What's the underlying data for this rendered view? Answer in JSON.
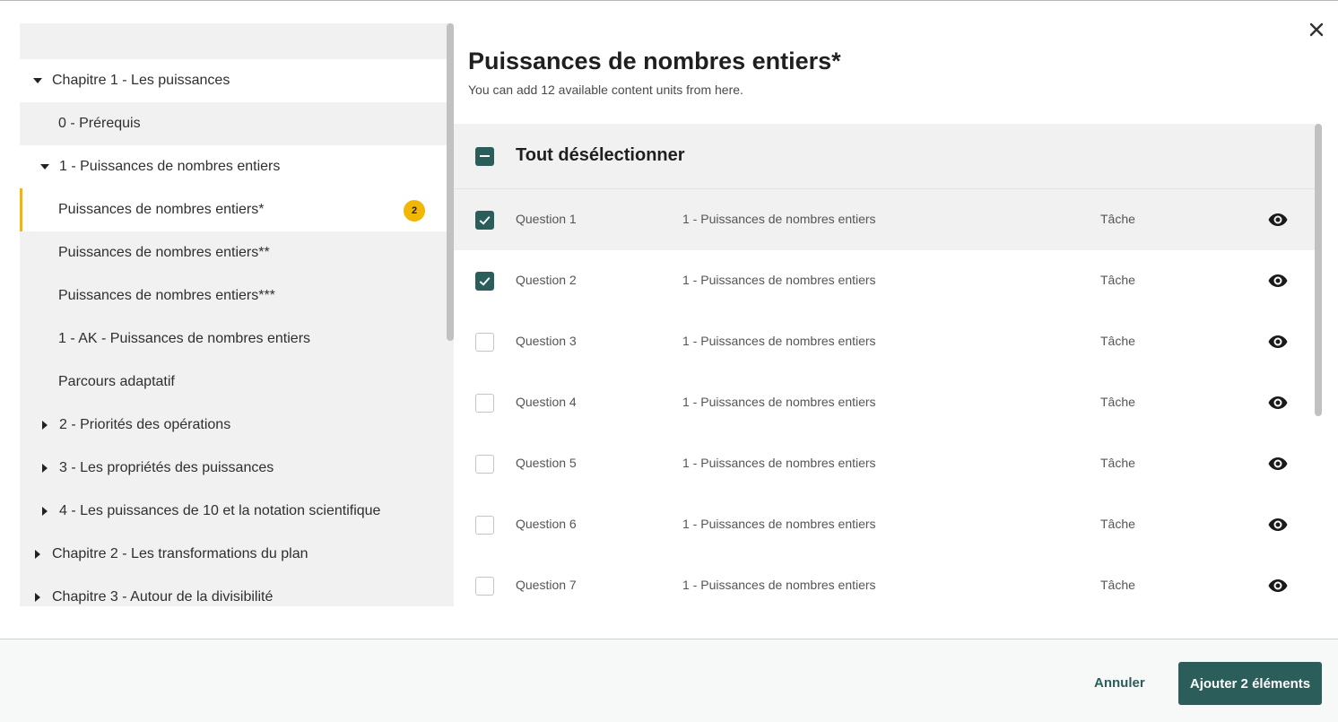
{
  "dialog": {
    "title": "Puissances de nombres entiers*",
    "subtitle": "You can add 12 available content units from here.",
    "close_icon": "close-icon"
  },
  "tree": {
    "items": [
      {
        "label": "Chapitre 1 - Les puissances",
        "caret": "down"
      },
      {
        "label": "0 - Prérequis",
        "caret": "none"
      },
      {
        "label": "1 - Puissances de nombres entiers",
        "caret": "down"
      },
      {
        "label": "Puissances de nombres entiers*",
        "caret": "none",
        "badge": "2"
      },
      {
        "label": "Puissances de nombres entiers**",
        "caret": "none"
      },
      {
        "label": "Puissances de nombres entiers***",
        "caret": "none"
      },
      {
        "label": "1 - AK - Puissances de nombres entiers",
        "caret": "none"
      },
      {
        "label": "Parcours adaptatif",
        "caret": "none"
      },
      {
        "label": "2 - Priorités des opérations",
        "caret": "right"
      },
      {
        "label": "3 - Les propriétés des puissances",
        "caret": "right"
      },
      {
        "label": "4 - Les puissances de 10 et la notation scientifique",
        "caret": "right"
      },
      {
        "label": "Chapitre 2 - Les transformations du plan",
        "caret": "right"
      },
      {
        "label": "Chapitre 3 - Autour de la divisibilité",
        "caret": "right"
      }
    ]
  },
  "list": {
    "select_all_label": "Tout désélectionner",
    "rows": [
      {
        "name": "Question 1",
        "source": "1 - Puissances de nombres entiers",
        "type": "Tâche",
        "checked": true
      },
      {
        "name": "Question 2",
        "source": "1 - Puissances de nombres entiers",
        "type": "Tâche",
        "checked": true
      },
      {
        "name": "Question 3",
        "source": "1 - Puissances de nombres entiers",
        "type": "Tâche",
        "checked": false
      },
      {
        "name": "Question 4",
        "source": "1 - Puissances de nombres entiers",
        "type": "Tâche",
        "checked": false
      },
      {
        "name": "Question 5",
        "source": "1 - Puissances de nombres entiers",
        "type": "Tâche",
        "checked": false
      },
      {
        "name": "Question 6",
        "source": "1 - Puissances de nombres entiers",
        "type": "Tâche",
        "checked": false
      },
      {
        "name": "Question 7",
        "source": "1 - Puissances de nombres entiers",
        "type": "Tâche",
        "checked": false
      }
    ]
  },
  "footer": {
    "cancel_label": "Annuler",
    "add_label": "Ajouter 2 éléments"
  },
  "colors": {
    "accent": "#2b5e5a",
    "badge": "#f2b705",
    "panel_bg": "#f0f1f0"
  }
}
